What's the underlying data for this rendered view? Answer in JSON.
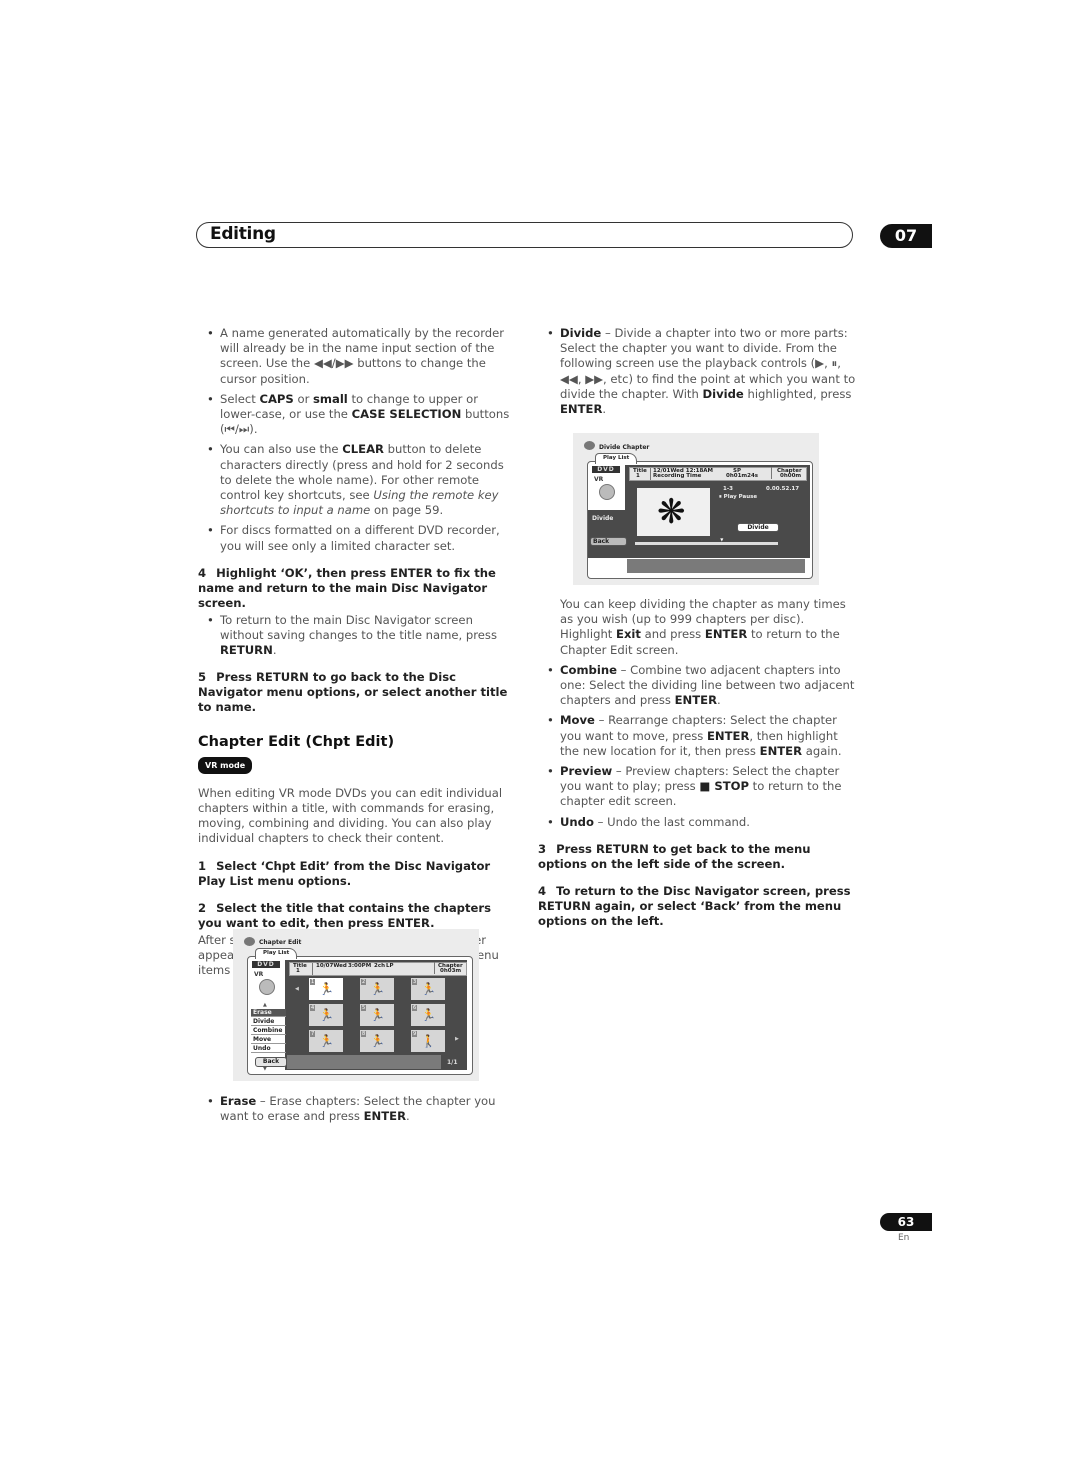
{
  "header": {
    "section_title": "Editing",
    "chapter_number": "07"
  },
  "left_column": {
    "bullets_top": [
      {
        "parts": [
          [
            "",
            "A name generated automatically by the recorder will already be in the name input section of the screen. Use the ◀◀/▶▶ buttons to change the cursor position."
          ]
        ]
      },
      {
        "parts": [
          [
            "",
            "Select "
          ],
          [
            "b",
            "CAPS"
          ],
          [
            "",
            " or "
          ],
          [
            "b",
            "small"
          ],
          [
            "",
            " to change to upper or lower-case, or use the "
          ],
          [
            "b",
            "CASE SELECTION"
          ],
          [
            "",
            " buttons (⏮/⏭)."
          ]
        ]
      },
      {
        "parts": [
          [
            "",
            "You can also use the "
          ],
          [
            "b",
            "CLEAR"
          ],
          [
            "",
            " button to delete characters directly (press and hold for 2 seconds to delete the whole name). For other remote control key shortcuts, see "
          ],
          [
            "i",
            "Using the remote key shortcuts to input a name"
          ],
          [
            "",
            " on page 59."
          ]
        ]
      },
      {
        "parts": [
          [
            "",
            "For discs formatted on a different DVD recorder, you will see only a limited character set."
          ]
        ]
      }
    ],
    "step4": {
      "num": "4",
      "text": "Highlight ‘OK’, then press ENTER to fix the name and return to the main Disc Navigator screen."
    },
    "step4_bullet": {
      "parts": [
        [
          "",
          "To return to the main Disc Navigator screen without saving changes to the title name, press "
        ],
        [
          "b",
          "RETURN"
        ],
        [
          "",
          "."
        ]
      ]
    },
    "step5": {
      "num": "5",
      "text": "Press RETURN to go back to the Disc Navigator menu options, or select another title to name."
    },
    "section_heading": "Chapter Edit (Chpt Edit)",
    "mode_badge": "VR mode",
    "intro": "When editing VR mode DVDs you can edit individual chapters within a title, with commands for erasing, moving, combining and dividing. You can also play individual chapters to check their content.",
    "step1": {
      "num": "1",
      "text": "Select ‘Chpt Edit’ from the Disc Navigator Play List menu options."
    },
    "step2": {
      "num": "2",
      "text": "Select the title that contains the chapters you want to edit, then press ENTER."
    },
    "step2_body": "After selecting a title, thumbnails of each chapter appear and you’ll see that the Disc Navigator menu items change to the chapter editing commands:",
    "erase_bullet": {
      "parts": [
        [
          "b",
          "Erase"
        ],
        [
          "",
          " – Erase chapters: Select the chapter you want to erase and press "
        ],
        [
          "b",
          "ENTER"
        ],
        [
          "",
          "."
        ]
      ]
    }
  },
  "chapter_edit_screen": {
    "title": "Chapter Edit",
    "tab": "Play List",
    "disc_logo": "DVD",
    "mode": "VR",
    "info": {
      "title_label": "Title",
      "title_num": "1",
      "date": "10/07Wed",
      "time": "3:00PM",
      "channel": "2ch",
      "rec_mode": "LP",
      "chapter_label": "Chapter",
      "chapter_time": "0h03m"
    },
    "thumbnails": [
      "1",
      "2",
      "3",
      "4",
      "5",
      "6",
      "7",
      "8",
      "9"
    ],
    "menu": [
      "Erase",
      "Divide",
      "Combine",
      "Move",
      "Undo"
    ],
    "active_menu": "Erase",
    "back_label": "Back",
    "page_indicator": "1/1"
  },
  "right_column": {
    "divide_bullet": {
      "parts": [
        [
          "b",
          "Divide"
        ],
        [
          "",
          " – Divide a chapter into two or more parts: Select the chapter you want to divide. From the following screen use the playback controls (▶, ⏸, ◀◀, ▶▶, etc) to find the point at which you want to divide the chapter. With "
        ],
        [
          "b",
          "Divide"
        ],
        [
          "",
          " highlighted, press "
        ],
        [
          "b",
          "ENTER"
        ],
        [
          "",
          "."
        ]
      ]
    },
    "divide_followup": {
      "parts": [
        [
          "",
          "You can keep dividing the chapter as many times as you wish (up to 999 chapters per disc). Highlight "
        ],
        [
          "b",
          "Exit"
        ],
        [
          "",
          " and press "
        ],
        [
          "b",
          "ENTER"
        ],
        [
          "",
          " to return to the Chapter Edit screen."
        ]
      ]
    },
    "bullets": [
      {
        "parts": [
          [
            "b",
            "Combine"
          ],
          [
            "",
            " – Combine two adjacent chapters into one: Select the dividing line between two adjacent chapters and press "
          ],
          [
            "b",
            "ENTER"
          ],
          [
            "",
            "."
          ]
        ]
      },
      {
        "parts": [
          [
            "b",
            "Move"
          ],
          [
            "",
            " – Rearrange chapters: Select the chapter you want to move, press "
          ],
          [
            "b",
            "ENTER"
          ],
          [
            "",
            ", then highlight the new location for it, then press "
          ],
          [
            "b",
            "ENTER"
          ],
          [
            "",
            " again."
          ]
        ]
      },
      {
        "parts": [
          [
            "b",
            "Preview"
          ],
          [
            "",
            " – Preview chapters: Select the chapter you want to play; press "
          ],
          [
            "b",
            "■ STOP"
          ],
          [
            "",
            " to return to the chapter edit screen."
          ]
        ]
      },
      {
        "parts": [
          [
            "b",
            "Undo"
          ],
          [
            "",
            " – Undo the last command."
          ]
        ]
      }
    ],
    "step3": {
      "num": "3",
      "text": "Press RETURN to get back to the menu options on the left side of the screen."
    },
    "step4": {
      "num": "4",
      "text": "To return to the Disc Navigator screen, press RETURN again, or select ‘Back’ from the menu options on the left."
    }
  },
  "divide_chapter_screen": {
    "title": "Divide Chapter",
    "tab": "Play List",
    "disc_logo": "DVD",
    "mode": "VR",
    "info": {
      "title_label": "Title",
      "title_num": "1",
      "date_time": "12/01Wed 12:18AM",
      "recording_label": "Recording Time",
      "rec_mode": "SP",
      "rec_time": "0h01m24s",
      "chapter_label": "Chapter",
      "chapter_time": "0h00m"
    },
    "chapter_pos": "1-3",
    "timecode": "0.00.52.17",
    "play_status": "⏸ Play Pause",
    "menu_label": "Divide",
    "divide_button": "Divide",
    "back_label": "Back",
    "position_fraction": 0.61
  },
  "footer": {
    "page_number": "63",
    "language": "En"
  }
}
